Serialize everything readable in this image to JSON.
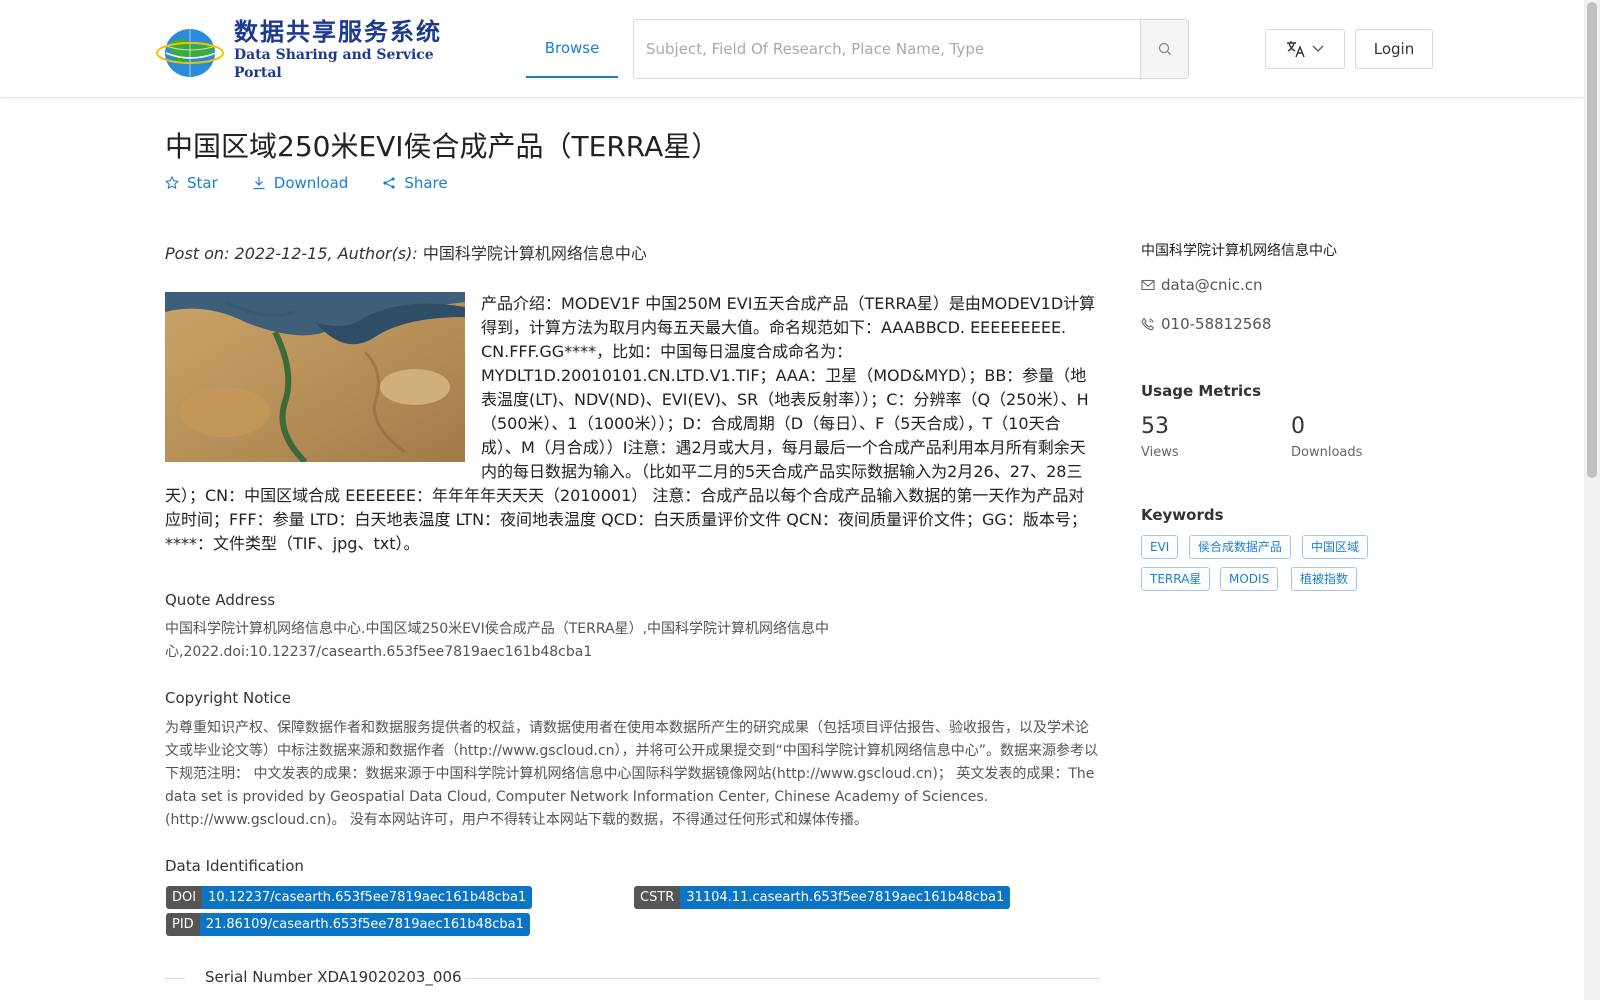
{
  "header": {
    "logo_cn": "数据共享服务系统",
    "logo_en": "Data Sharing and Service Portal",
    "nav_browse": "Browse",
    "search_placeholder": "Subject, Field Of Research, Place Name, Type",
    "login": "Login"
  },
  "dataset": {
    "title": "中国区域250米EVI侯合成产品（TERRA星）",
    "actions": {
      "star": "Star",
      "download": "Download",
      "share": "Share"
    },
    "post_prefix": "Post on: 2022-12-15, Author(s): ",
    "author": "中国科学院计算机网络信息中心",
    "description": "产品介绍：MODEV1F 中国250M EVI五天合成产品（TERRA星）是由MODEV1D计算得到，计算方法为取月内每五天最大值。命名规范如下：AAABBCD. EEEEEEEEE. CN.FFF.GG****，比如：中国每日温度合成命名为：MYDLT1D.20010101.CN.LTD.V1.TIF；AAA：卫星（MOD&MYD）；BB：参量（地表温度(LT)、NDV(ND)、EVI(EV)、SR（地表反射率））；C：分辨率（Q（250米）、H（500米）、1（1000米））；D：合成周期（D（每日）、F（5天合成），T（10天合成）、M（月合成））Ⅰ注意：遇2月或大月，每月最后一个合成产品利用本月所有剩余天内的每日数据为输入。（比如平二月的5天合成产品实际数据输入为2月26、27、28三天）；CN：中国区域合成 EEEEEEE：年年年年天天天（2010001） 注意：合成产品以每个合成产品输入数据的第一天作为产品对应时间；FFF：参量 LTD：白天地表温度 LTN：夜间地表温度 QCD：白天质量评价文件 QCN：夜间质量评价文件；GG：版本号；****：文件类型（TIF、jpg、txt）。",
    "quote_title": "Quote Address",
    "quote_text": "中国科学院计算机网络信息中心.中国区域250米EVI侯合成产品（TERRA星）,中国科学院计算机网络信息中心,2022.doi:10.12237/casearth.653f5ee7819aec161b48cba1",
    "copyright_title": "Copyright Notice",
    "copyright_text": "为尊重知识产权、保障数据作者和数据服务提供者的权益，请数据使用者在使用本数据所产生的研究成果（包括项目评估报告、验收报告，以及学术论文或毕业论文等）中标注数据来源和数据作者（http://www.gscloud.cn），并将可公开成果提交到“中国科学院计算机网络信息中心”。数据来源参考以下规范注明： 中文发表的成果：数据来源于中国科学院计算机网络信息中心国际科学数据镜像网站(http://www.gscloud.cn)； 英文发表的成果：The data set is provided by Geospatial Data Cloud, Computer Network Information Center, Chinese Academy of Sciences.(http://www.gscloud.cn)。 没有本网站许可，用户不得转让本网站下载的数据，不得通过任何形式和媒体传播。",
    "identification_title": "Data Identification",
    "doi_key": "DOI",
    "doi_value": "10.12237/casearth.653f5ee7819aec161b48cba1",
    "cstr_key": "CSTR",
    "cstr_value": "31104.11.casearth.653f5ee7819aec161b48cba1",
    "pid_key": "PID",
    "pid_value": "21.86109/casearth.653f5ee7819aec161b48cba1",
    "serial": "Serial Number XDA19020203_006"
  },
  "sidebar": {
    "org": "中国科学院计算机网络信息中心",
    "email": "data@cnic.cn",
    "phone": "010-58812568",
    "metrics_title": "Usage Metrics",
    "views_num": "53",
    "views_label": "Views",
    "downloads_num": "0",
    "downloads_label": "Downloads",
    "keywords_title": "Keywords",
    "keywords": [
      "EVI",
      "侯合成数据产品",
      "中国区域",
      "TERRA星",
      "MODIS",
      "植被指数"
    ]
  },
  "colors": {
    "accent": "#1a7fd4",
    "badge_value": "#0b74c4",
    "badge_key": "#555555"
  }
}
